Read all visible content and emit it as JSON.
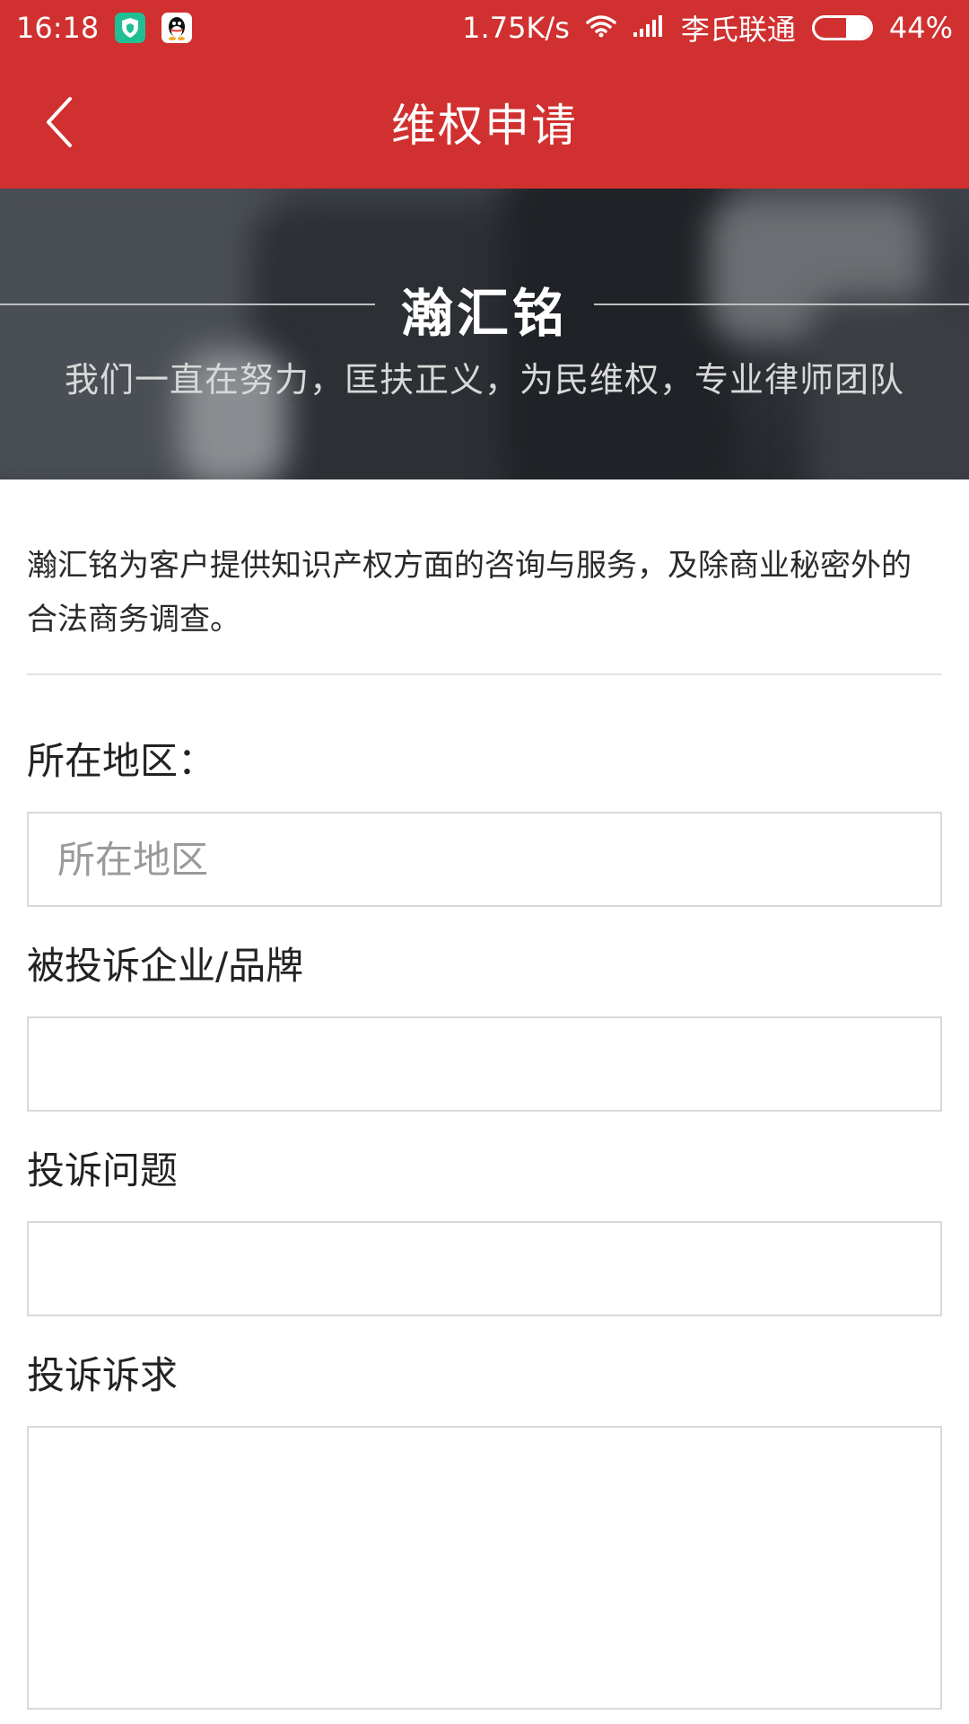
{
  "status_bar": {
    "time": "16:18",
    "network_speed": "1.75K/s",
    "carrier": "李氏联通",
    "battery_percent": "44%",
    "battery_level": 0.44,
    "icons": [
      "shield-app-icon",
      "qq-icon",
      "wifi-icon",
      "signal-icon",
      "battery-icon"
    ]
  },
  "header": {
    "title": "维权申请",
    "back_icon": "chevron-left-icon",
    "background_color": "#d0302f"
  },
  "banner": {
    "title": "瀚汇铭",
    "subtitle": "我们一直在努力，匡扶正义，为民维权，专业律师团队"
  },
  "intro": {
    "text": "瀚汇铭为客户提供知识产权方面的咨询与服务，及除商业秘密外的 合法商务调查。"
  },
  "form": {
    "region": {
      "label": "所在地区：",
      "placeholder": "所在地区",
      "value": ""
    },
    "company": {
      "label": "被投诉企业/品牌",
      "placeholder": "",
      "value": ""
    },
    "issue": {
      "label": "投诉问题",
      "placeholder": "",
      "value": ""
    },
    "demand": {
      "label": "投诉诉求",
      "placeholder": "",
      "value": ""
    }
  }
}
